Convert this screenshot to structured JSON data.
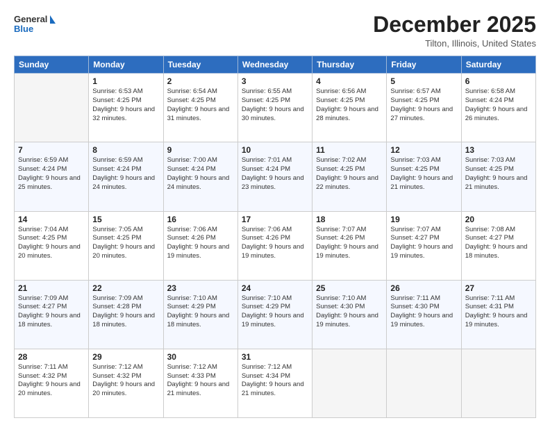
{
  "header": {
    "logo_line1": "General",
    "logo_line2": "Blue",
    "month_title": "December 2025",
    "location": "Tilton, Illinois, United States"
  },
  "weekdays": [
    "Sunday",
    "Monday",
    "Tuesday",
    "Wednesday",
    "Thursday",
    "Friday",
    "Saturday"
  ],
  "weeks": [
    [
      {
        "day": "",
        "sunrise": "",
        "sunset": "",
        "daylight": ""
      },
      {
        "day": "1",
        "sunrise": "Sunrise: 6:53 AM",
        "sunset": "Sunset: 4:25 PM",
        "daylight": "Daylight: 9 hours and 32 minutes."
      },
      {
        "day": "2",
        "sunrise": "Sunrise: 6:54 AM",
        "sunset": "Sunset: 4:25 PM",
        "daylight": "Daylight: 9 hours and 31 minutes."
      },
      {
        "day": "3",
        "sunrise": "Sunrise: 6:55 AM",
        "sunset": "Sunset: 4:25 PM",
        "daylight": "Daylight: 9 hours and 30 minutes."
      },
      {
        "day": "4",
        "sunrise": "Sunrise: 6:56 AM",
        "sunset": "Sunset: 4:25 PM",
        "daylight": "Daylight: 9 hours and 28 minutes."
      },
      {
        "day": "5",
        "sunrise": "Sunrise: 6:57 AM",
        "sunset": "Sunset: 4:25 PM",
        "daylight": "Daylight: 9 hours and 27 minutes."
      },
      {
        "day": "6",
        "sunrise": "Sunrise: 6:58 AM",
        "sunset": "Sunset: 4:24 PM",
        "daylight": "Daylight: 9 hours and 26 minutes."
      }
    ],
    [
      {
        "day": "7",
        "sunrise": "Sunrise: 6:59 AM",
        "sunset": "Sunset: 4:24 PM",
        "daylight": "Daylight: 9 hours and 25 minutes."
      },
      {
        "day": "8",
        "sunrise": "Sunrise: 6:59 AM",
        "sunset": "Sunset: 4:24 PM",
        "daylight": "Daylight: 9 hours and 24 minutes."
      },
      {
        "day": "9",
        "sunrise": "Sunrise: 7:00 AM",
        "sunset": "Sunset: 4:24 PM",
        "daylight": "Daylight: 9 hours and 24 minutes."
      },
      {
        "day": "10",
        "sunrise": "Sunrise: 7:01 AM",
        "sunset": "Sunset: 4:24 PM",
        "daylight": "Daylight: 9 hours and 23 minutes."
      },
      {
        "day": "11",
        "sunrise": "Sunrise: 7:02 AM",
        "sunset": "Sunset: 4:25 PM",
        "daylight": "Daylight: 9 hours and 22 minutes."
      },
      {
        "day": "12",
        "sunrise": "Sunrise: 7:03 AM",
        "sunset": "Sunset: 4:25 PM",
        "daylight": "Daylight: 9 hours and 21 minutes."
      },
      {
        "day": "13",
        "sunrise": "Sunrise: 7:03 AM",
        "sunset": "Sunset: 4:25 PM",
        "daylight": "Daylight: 9 hours and 21 minutes."
      }
    ],
    [
      {
        "day": "14",
        "sunrise": "Sunrise: 7:04 AM",
        "sunset": "Sunset: 4:25 PM",
        "daylight": "Daylight: 9 hours and 20 minutes."
      },
      {
        "day": "15",
        "sunrise": "Sunrise: 7:05 AM",
        "sunset": "Sunset: 4:25 PM",
        "daylight": "Daylight: 9 hours and 20 minutes."
      },
      {
        "day": "16",
        "sunrise": "Sunrise: 7:06 AM",
        "sunset": "Sunset: 4:26 PM",
        "daylight": "Daylight: 9 hours and 19 minutes."
      },
      {
        "day": "17",
        "sunrise": "Sunrise: 7:06 AM",
        "sunset": "Sunset: 4:26 PM",
        "daylight": "Daylight: 9 hours and 19 minutes."
      },
      {
        "day": "18",
        "sunrise": "Sunrise: 7:07 AM",
        "sunset": "Sunset: 4:26 PM",
        "daylight": "Daylight: 9 hours and 19 minutes."
      },
      {
        "day": "19",
        "sunrise": "Sunrise: 7:07 AM",
        "sunset": "Sunset: 4:27 PM",
        "daylight": "Daylight: 9 hours and 19 minutes."
      },
      {
        "day": "20",
        "sunrise": "Sunrise: 7:08 AM",
        "sunset": "Sunset: 4:27 PM",
        "daylight": "Daylight: 9 hours and 18 minutes."
      }
    ],
    [
      {
        "day": "21",
        "sunrise": "Sunrise: 7:09 AM",
        "sunset": "Sunset: 4:27 PM",
        "daylight": "Daylight: 9 hours and 18 minutes."
      },
      {
        "day": "22",
        "sunrise": "Sunrise: 7:09 AM",
        "sunset": "Sunset: 4:28 PM",
        "daylight": "Daylight: 9 hours and 18 minutes."
      },
      {
        "day": "23",
        "sunrise": "Sunrise: 7:10 AM",
        "sunset": "Sunset: 4:29 PM",
        "daylight": "Daylight: 9 hours and 18 minutes."
      },
      {
        "day": "24",
        "sunrise": "Sunrise: 7:10 AM",
        "sunset": "Sunset: 4:29 PM",
        "daylight": "Daylight: 9 hours and 19 minutes."
      },
      {
        "day": "25",
        "sunrise": "Sunrise: 7:10 AM",
        "sunset": "Sunset: 4:30 PM",
        "daylight": "Daylight: 9 hours and 19 minutes."
      },
      {
        "day": "26",
        "sunrise": "Sunrise: 7:11 AM",
        "sunset": "Sunset: 4:30 PM",
        "daylight": "Daylight: 9 hours and 19 minutes."
      },
      {
        "day": "27",
        "sunrise": "Sunrise: 7:11 AM",
        "sunset": "Sunset: 4:31 PM",
        "daylight": "Daylight: 9 hours and 19 minutes."
      }
    ],
    [
      {
        "day": "28",
        "sunrise": "Sunrise: 7:11 AM",
        "sunset": "Sunset: 4:32 PM",
        "daylight": "Daylight: 9 hours and 20 minutes."
      },
      {
        "day": "29",
        "sunrise": "Sunrise: 7:12 AM",
        "sunset": "Sunset: 4:32 PM",
        "daylight": "Daylight: 9 hours and 20 minutes."
      },
      {
        "day": "30",
        "sunrise": "Sunrise: 7:12 AM",
        "sunset": "Sunset: 4:33 PM",
        "daylight": "Daylight: 9 hours and 21 minutes."
      },
      {
        "day": "31",
        "sunrise": "Sunrise: 7:12 AM",
        "sunset": "Sunset: 4:34 PM",
        "daylight": "Daylight: 9 hours and 21 minutes."
      },
      {
        "day": "",
        "sunrise": "",
        "sunset": "",
        "daylight": ""
      },
      {
        "day": "",
        "sunrise": "",
        "sunset": "",
        "daylight": ""
      },
      {
        "day": "",
        "sunrise": "",
        "sunset": "",
        "daylight": ""
      }
    ]
  ]
}
